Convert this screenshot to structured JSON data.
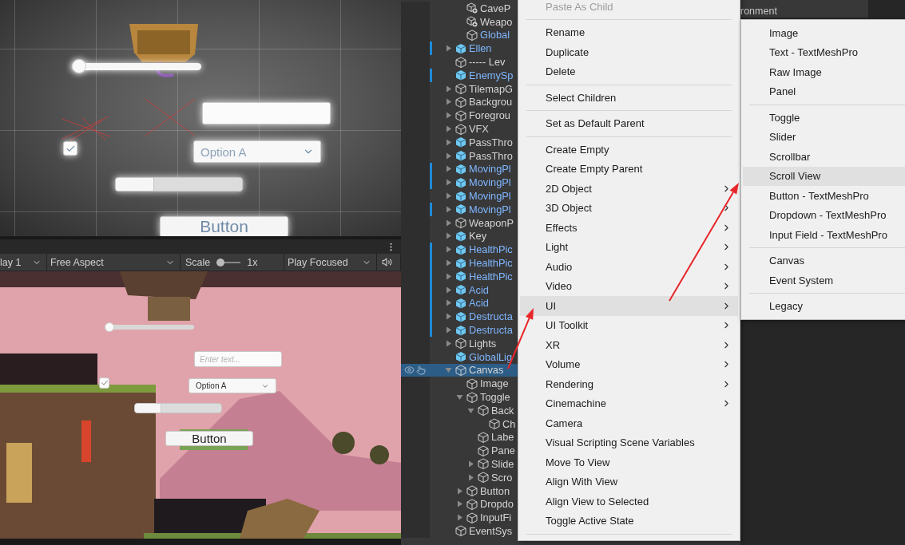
{
  "scene_view": {
    "widgets": [
      {
        "kind": "slider",
        "level": 0
      },
      {
        "kind": "input"
      },
      {
        "kind": "toggle",
        "checked": true
      },
      {
        "kind": "dropdown",
        "value": "Option A"
      },
      {
        "kind": "scrollbar"
      },
      {
        "kind": "button",
        "label": "Button"
      }
    ]
  },
  "game_view": {
    "toolbar": {
      "display": "lay 1",
      "aspect": "Free Aspect",
      "scale_label": "Scale",
      "scale": {
        "level": 0
      },
      "scale_value": "1x",
      "play_mode": "Play Focused"
    },
    "widgets": [
      {
        "kind": "slider",
        "level": 0
      },
      {
        "kind": "input",
        "placeholder": "Enter text..."
      },
      {
        "kind": "toggle",
        "checked": true
      },
      {
        "kind": "dropdown",
        "value": "Option A"
      },
      {
        "kind": "scrollbar"
      },
      {
        "kind": "button",
        "label": "Button"
      }
    ]
  },
  "hierarchy": {
    "items": [
      {
        "children": [
          {
            "label": "CaveP",
            "kind": "variant",
            "linked": false,
            "overridden": false,
            "selected": false
          },
          {
            "label": "Weapo",
            "kind": "variant",
            "linked": false,
            "overridden": false,
            "selected": false
          },
          {
            "label": "Global",
            "kind": "object",
            "linked": true,
            "overridden": false,
            "selected": false
          }
        ]
      },
      {
        "label": "Ellen",
        "kind": "prefab",
        "linked": true,
        "overridden": true,
        "expanded": false,
        "selected": false
      },
      {
        "label": "----- Lev",
        "kind": "object",
        "linked": false,
        "overridden": false,
        "selected": false
      },
      {
        "label": "EnemySp",
        "kind": "prefab",
        "linked": true,
        "overridden": true,
        "selected": false
      },
      {
        "label": "TilemapG",
        "kind": "object",
        "linked": false,
        "overridden": false,
        "expanded": false,
        "selected": false
      },
      {
        "label": "Backgrou",
        "kind": "object",
        "linked": false,
        "overridden": false,
        "expanded": false,
        "selected": false
      },
      {
        "label": "Foregrou",
        "kind": "object",
        "linked": false,
        "overridden": false,
        "expanded": false,
        "selected": false
      },
      {
        "label": "VFX",
        "kind": "object",
        "linked": false,
        "overridden": false,
        "expanded": false,
        "selected": false
      },
      {
        "label": "PassThro",
        "kind": "prefab",
        "linked": false,
        "overridden": false,
        "expanded": false,
        "selected": false
      },
      {
        "label": "PassThro",
        "kind": "prefab",
        "linked": false,
        "overridden": false,
        "expanded": false,
        "selected": false
      },
      {
        "label": "MovingPl",
        "kind": "prefab",
        "linked": true,
        "overridden": true,
        "expanded": false,
        "selected": false
      },
      {
        "label": "MovingPl",
        "kind": "prefab",
        "linked": true,
        "overridden": true,
        "expanded": false,
        "selected": false
      },
      {
        "label": "MovingPl",
        "kind": "prefab",
        "linked": true,
        "overridden": false,
        "expanded": false,
        "selected": false
      },
      {
        "label": "MovingPl",
        "kind": "prefab",
        "linked": true,
        "overridden": true,
        "expanded": false,
        "selected": false
      },
      {
        "label": "WeaponP",
        "kind": "object",
        "linked": false,
        "overridden": false,
        "expanded": false,
        "selected": false
      },
      {
        "label": "Key",
        "kind": "prefab",
        "linked": false,
        "overridden": false,
        "expanded": false,
        "selected": false
      },
      {
        "label": "HealthPic",
        "kind": "prefab",
        "linked": true,
        "overridden": true,
        "expanded": false,
        "selected": false
      },
      {
        "label": "HealthPic",
        "kind": "prefab",
        "linked": true,
        "overridden": true,
        "expanded": false,
        "selected": false
      },
      {
        "label": "HealthPic",
        "kind": "prefab",
        "linked": true,
        "overridden": true,
        "expanded": false,
        "selected": false
      },
      {
        "label": "Acid",
        "kind": "prefab",
        "linked": true,
        "overridden": true,
        "expanded": false,
        "selected": false
      },
      {
        "label": "Acid",
        "kind": "prefab",
        "linked": true,
        "overridden": true,
        "expanded": false,
        "selected": false
      },
      {
        "label": "Destructa",
        "kind": "prefab",
        "linked": true,
        "overridden": true,
        "expanded": false,
        "selected": false
      },
      {
        "label": "Destructa",
        "kind": "prefab",
        "linked": true,
        "overridden": true,
        "expanded": false,
        "selected": false
      },
      {
        "label": "Lights",
        "kind": "object",
        "linked": false,
        "overridden": false,
        "expanded": false,
        "selected": false
      },
      {
        "label": "GlobalLig",
        "kind": "prefab",
        "linked": true,
        "overridden": false,
        "selected": false
      },
      {
        "label": "Canvas",
        "kind": "object",
        "linked": false,
        "overridden": false,
        "expanded": true,
        "selected": true,
        "children": [
          {
            "label": "Image",
            "kind": "object",
            "linked": false,
            "overridden": false,
            "selected": false
          },
          {
            "label": "Toggle",
            "kind": "object",
            "linked": false,
            "overridden": false,
            "expanded": true,
            "selected": false,
            "children": [
              {
                "label": "Back",
                "kind": "object",
                "linked": false,
                "overridden": false,
                "expanded": true,
                "selected": false,
                "children": [
                  {
                    "label": "Ch",
                    "kind": "object",
                    "linked": false,
                    "overridden": false,
                    "selected": false
                  }
                ]
              },
              {
                "label": "Labe",
                "kind": "object",
                "linked": false,
                "overridden": false,
                "selected": false
              },
              {
                "label": "Pane",
                "kind": "object",
                "linked": false,
                "overridden": false,
                "selected": false
              },
              {
                "label": "Slide",
                "kind": "object",
                "linked": false,
                "overridden": false,
                "expanded": false,
                "selected": false
              },
              {
                "label": "Scro",
                "kind": "object",
                "linked": false,
                "overridden": false,
                "expanded": false,
                "selected": false
              }
            ]
          },
          {
            "label": "Button",
            "kind": "object",
            "linked": false,
            "overridden": false,
            "expanded": false,
            "selected": false
          },
          {
            "label": "Dropdo",
            "kind": "object",
            "linked": false,
            "overridden": false,
            "expanded": false,
            "selected": false
          },
          {
            "label": "InputFi",
            "kind": "object",
            "linked": false,
            "overridden": false,
            "expanded": false,
            "selected": false
          }
        ]
      },
      {
        "label": "EventSys",
        "kind": "object",
        "linked": false,
        "overridden": false,
        "selected": false
      }
    ]
  },
  "background_panel": {
    "lines": [
      "ronment"
    ]
  },
  "context_menu": {
    "items": [
      {
        "kind": "item",
        "label": "Paste As Child",
        "disabled": true,
        "submenu": false,
        "selected": false
      },
      {
        "kind": "separator"
      },
      {
        "kind": "item",
        "label": "Rename",
        "disabled": false,
        "submenu": false,
        "selected": false
      },
      {
        "kind": "item",
        "label": "Duplicate",
        "disabled": false,
        "submenu": false,
        "selected": false
      },
      {
        "kind": "item",
        "label": "Delete",
        "disabled": false,
        "submenu": false,
        "selected": false
      },
      {
        "kind": "separator"
      },
      {
        "kind": "item",
        "label": "Select Children",
        "disabled": false,
        "submenu": false,
        "selected": false
      },
      {
        "kind": "separator"
      },
      {
        "kind": "item",
        "label": "Set as Default Parent",
        "disabled": false,
        "submenu": false,
        "selected": false
      },
      {
        "kind": "separator"
      },
      {
        "kind": "item",
        "label": "Create Empty",
        "disabled": false,
        "submenu": false,
        "selected": false
      },
      {
        "kind": "item",
        "label": "Create Empty Parent",
        "disabled": false,
        "submenu": false,
        "selected": false
      },
      {
        "kind": "item",
        "label": "2D Object",
        "disabled": false,
        "submenu": true,
        "selected": false
      },
      {
        "kind": "item",
        "label": "3D Object",
        "disabled": false,
        "submenu": true,
        "selected": false
      },
      {
        "kind": "item",
        "label": "Effects",
        "disabled": false,
        "submenu": true,
        "selected": false
      },
      {
        "kind": "item",
        "label": "Light",
        "disabled": false,
        "submenu": true,
        "selected": false
      },
      {
        "kind": "item",
        "label": "Audio",
        "disabled": false,
        "submenu": true,
        "selected": false
      },
      {
        "kind": "item",
        "label": "Video",
        "disabled": false,
        "submenu": true,
        "selected": false
      },
      {
        "kind": "item",
        "label": "UI",
        "disabled": false,
        "submenu": true,
        "selected": true
      },
      {
        "kind": "item",
        "label": "UI Toolkit",
        "disabled": false,
        "submenu": true,
        "selected": false
      },
      {
        "kind": "item",
        "label": "XR",
        "disabled": false,
        "submenu": true,
        "selected": false
      },
      {
        "kind": "item",
        "label": "Volume",
        "disabled": false,
        "submenu": true,
        "selected": false
      },
      {
        "kind": "item",
        "label": "Rendering",
        "disabled": false,
        "submenu": true,
        "selected": false
      },
      {
        "kind": "item",
        "label": "Cinemachine",
        "disabled": false,
        "submenu": true,
        "selected": false
      },
      {
        "kind": "item",
        "label": "Camera",
        "disabled": false,
        "submenu": false,
        "selected": false
      },
      {
        "kind": "item",
        "label": "Visual Scripting Scene Variables",
        "disabled": false,
        "submenu": false,
        "selected": false
      },
      {
        "kind": "item",
        "label": "Move To View",
        "disabled": false,
        "submenu": false,
        "selected": false
      },
      {
        "kind": "item",
        "label": "Align With View",
        "disabled": false,
        "submenu": false,
        "selected": false
      },
      {
        "kind": "item",
        "label": "Align View to Selected",
        "disabled": false,
        "submenu": false,
        "selected": false
      },
      {
        "kind": "item",
        "label": "Toggle Active State",
        "disabled": false,
        "submenu": false,
        "selected": false
      },
      {
        "kind": "separator"
      }
    ]
  },
  "ui_submenu": {
    "items": [
      {
        "kind": "item",
        "label": "Image",
        "selected": false
      },
      {
        "kind": "item",
        "label": "Text - TextMeshPro",
        "selected": false
      },
      {
        "kind": "item",
        "label": "Raw Image",
        "selected": false
      },
      {
        "kind": "item",
        "label": "Panel",
        "selected": false
      },
      {
        "kind": "separator"
      },
      {
        "kind": "item",
        "label": "Toggle",
        "selected": false
      },
      {
        "kind": "item",
        "label": "Slider",
        "selected": false
      },
      {
        "kind": "item",
        "label": "Scrollbar",
        "selected": false
      },
      {
        "kind": "item",
        "label": "Scroll View",
        "selected": true
      },
      {
        "kind": "item",
        "label": "Button - TextMeshPro",
        "selected": false
      },
      {
        "kind": "item",
        "label": "Dropdown - TextMeshPro",
        "selected": false
      },
      {
        "kind": "item",
        "label": "Input Field - TextMeshPro",
        "selected": false
      },
      {
        "kind": "separator"
      },
      {
        "kind": "item",
        "label": "Canvas",
        "selected": false
      },
      {
        "kind": "item",
        "label": "Event System",
        "selected": false
      },
      {
        "kind": "separator"
      },
      {
        "kind": "item",
        "label": "Legacy",
        "selected": false
      }
    ]
  }
}
